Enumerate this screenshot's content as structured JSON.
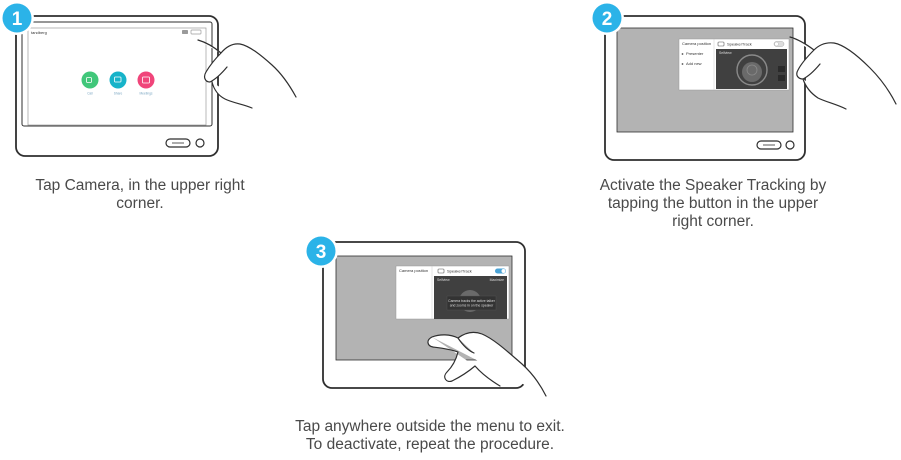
{
  "colors": {
    "badge": "#2bb3e8",
    "badge_ring": "#ffffff",
    "device_stroke": "#2f2f2f",
    "screen_bg": "#ffffff",
    "screen_grey": "#b3b3b3",
    "call_green": "#41c77a",
    "share_teal": "#17b3c9",
    "meetings_pink": "#f0457a",
    "toggle_blue": "#4aa3d6",
    "caption": "#4a4a4a"
  },
  "steps": [
    {
      "number": "1",
      "caption_lines": [
        "Tap Camera, in the upper right",
        "corner."
      ],
      "screen": {
        "top_left_text": "tandberg",
        "apps": [
          {
            "label": "Call",
            "icon": "video-call-icon"
          },
          {
            "label": "Share",
            "icon": "share-icon"
          },
          {
            "label": "Meetings",
            "icon": "calendar-icon"
          }
        ]
      }
    },
    {
      "number": "2",
      "caption_lines": [
        "Activate the Speaker Tracking by",
        "tapping the button in the upper",
        "right corner."
      ],
      "menu": {
        "title": "Camera position",
        "items": [
          "Presenter",
          "Add new"
        ],
        "toggle_label": "SpeakerTrack",
        "self_view_label": "Selfview",
        "toggle_on": false
      }
    },
    {
      "number": "3",
      "caption_lines": [
        "Tap anywhere outside the menu to exit.",
        "To deactivate, repeat the procedure."
      ],
      "menu": {
        "title": "Camera position",
        "toggle_label": "SpeakerTrack",
        "self_view_label": "Selfview",
        "minimize_label": "Maximize",
        "toggle_on": true,
        "notice_lines": [
          "Camera tracks the active talker",
          "and zooms in on the speaker"
        ]
      }
    }
  ]
}
